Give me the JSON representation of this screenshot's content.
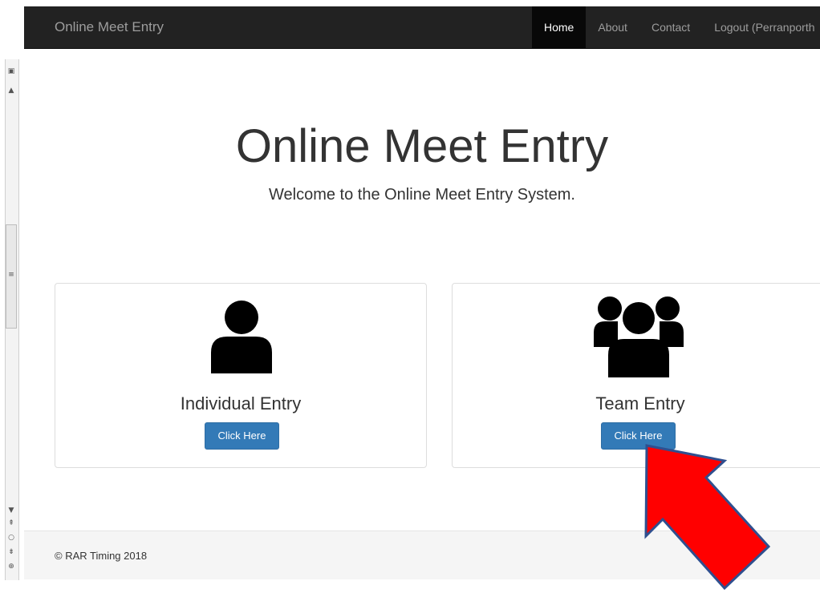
{
  "navbar": {
    "brand": "Online Meet Entry",
    "items": [
      {
        "label": "Home",
        "active": true
      },
      {
        "label": "About"
      },
      {
        "label": "Contact"
      },
      {
        "label": "Logout (Perranporth"
      }
    ]
  },
  "jumbotron": {
    "title": "Online Meet Entry",
    "subtitle": "Welcome to the Online Meet Entry System."
  },
  "panels": [
    {
      "heading": "Individual Entry",
      "button": "Click Here",
      "icon": "user-icon"
    },
    {
      "heading": "Team Entry",
      "button": "Click Here",
      "icon": "users-icon"
    }
  ],
  "footer": {
    "text": "© RAR Timing 2018"
  },
  "colors": {
    "navbar_bg": "#222222",
    "button": "#337ab7",
    "annotation_arrow": "#ff0000",
    "annotation_outline": "#2f4f8f"
  }
}
